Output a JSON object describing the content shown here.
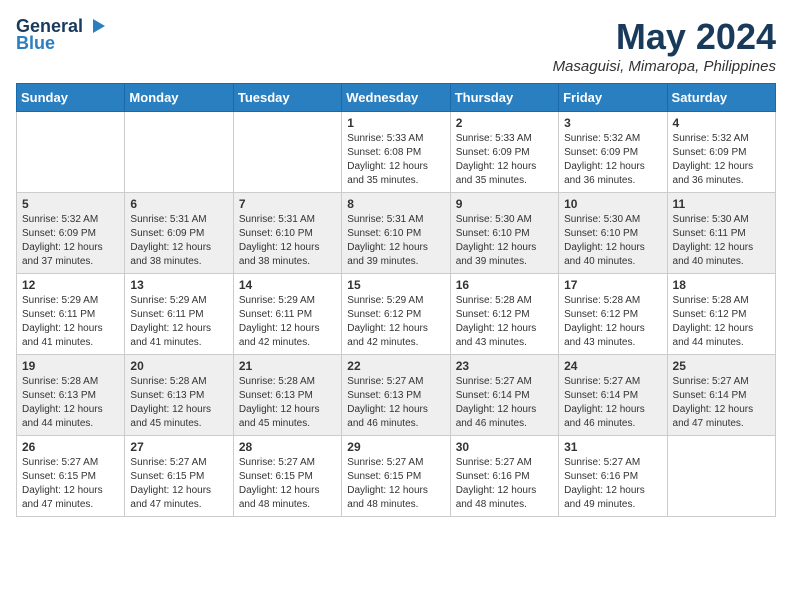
{
  "logo": {
    "general": "General",
    "blue": "Blue"
  },
  "title": {
    "month": "May 2024",
    "location": "Masaguisi, Mimaropa, Philippines"
  },
  "days_of_week": [
    "Sunday",
    "Monday",
    "Tuesday",
    "Wednesday",
    "Thursday",
    "Friday",
    "Saturday"
  ],
  "weeks": [
    [
      {
        "day": "",
        "info": ""
      },
      {
        "day": "",
        "info": ""
      },
      {
        "day": "",
        "info": ""
      },
      {
        "day": "1",
        "info": "Sunrise: 5:33 AM\nSunset: 6:08 PM\nDaylight: 12 hours\nand 35 minutes."
      },
      {
        "day": "2",
        "info": "Sunrise: 5:33 AM\nSunset: 6:09 PM\nDaylight: 12 hours\nand 35 minutes."
      },
      {
        "day": "3",
        "info": "Sunrise: 5:32 AM\nSunset: 6:09 PM\nDaylight: 12 hours\nand 36 minutes."
      },
      {
        "day": "4",
        "info": "Sunrise: 5:32 AM\nSunset: 6:09 PM\nDaylight: 12 hours\nand 36 minutes."
      }
    ],
    [
      {
        "day": "5",
        "info": "Sunrise: 5:32 AM\nSunset: 6:09 PM\nDaylight: 12 hours\nand 37 minutes."
      },
      {
        "day": "6",
        "info": "Sunrise: 5:31 AM\nSunset: 6:09 PM\nDaylight: 12 hours\nand 38 minutes."
      },
      {
        "day": "7",
        "info": "Sunrise: 5:31 AM\nSunset: 6:10 PM\nDaylight: 12 hours\nand 38 minutes."
      },
      {
        "day": "8",
        "info": "Sunrise: 5:31 AM\nSunset: 6:10 PM\nDaylight: 12 hours\nand 39 minutes."
      },
      {
        "day": "9",
        "info": "Sunrise: 5:30 AM\nSunset: 6:10 PM\nDaylight: 12 hours\nand 39 minutes."
      },
      {
        "day": "10",
        "info": "Sunrise: 5:30 AM\nSunset: 6:10 PM\nDaylight: 12 hours\nand 40 minutes."
      },
      {
        "day": "11",
        "info": "Sunrise: 5:30 AM\nSunset: 6:11 PM\nDaylight: 12 hours\nand 40 minutes."
      }
    ],
    [
      {
        "day": "12",
        "info": "Sunrise: 5:29 AM\nSunset: 6:11 PM\nDaylight: 12 hours\nand 41 minutes."
      },
      {
        "day": "13",
        "info": "Sunrise: 5:29 AM\nSunset: 6:11 PM\nDaylight: 12 hours\nand 41 minutes."
      },
      {
        "day": "14",
        "info": "Sunrise: 5:29 AM\nSunset: 6:11 PM\nDaylight: 12 hours\nand 42 minutes."
      },
      {
        "day": "15",
        "info": "Sunrise: 5:29 AM\nSunset: 6:12 PM\nDaylight: 12 hours\nand 42 minutes."
      },
      {
        "day": "16",
        "info": "Sunrise: 5:28 AM\nSunset: 6:12 PM\nDaylight: 12 hours\nand 43 minutes."
      },
      {
        "day": "17",
        "info": "Sunrise: 5:28 AM\nSunset: 6:12 PM\nDaylight: 12 hours\nand 43 minutes."
      },
      {
        "day": "18",
        "info": "Sunrise: 5:28 AM\nSunset: 6:12 PM\nDaylight: 12 hours\nand 44 minutes."
      }
    ],
    [
      {
        "day": "19",
        "info": "Sunrise: 5:28 AM\nSunset: 6:13 PM\nDaylight: 12 hours\nand 44 minutes."
      },
      {
        "day": "20",
        "info": "Sunrise: 5:28 AM\nSunset: 6:13 PM\nDaylight: 12 hours\nand 45 minutes."
      },
      {
        "day": "21",
        "info": "Sunrise: 5:28 AM\nSunset: 6:13 PM\nDaylight: 12 hours\nand 45 minutes."
      },
      {
        "day": "22",
        "info": "Sunrise: 5:27 AM\nSunset: 6:13 PM\nDaylight: 12 hours\nand 46 minutes."
      },
      {
        "day": "23",
        "info": "Sunrise: 5:27 AM\nSunset: 6:14 PM\nDaylight: 12 hours\nand 46 minutes."
      },
      {
        "day": "24",
        "info": "Sunrise: 5:27 AM\nSunset: 6:14 PM\nDaylight: 12 hours\nand 46 minutes."
      },
      {
        "day": "25",
        "info": "Sunrise: 5:27 AM\nSunset: 6:14 PM\nDaylight: 12 hours\nand 47 minutes."
      }
    ],
    [
      {
        "day": "26",
        "info": "Sunrise: 5:27 AM\nSunset: 6:15 PM\nDaylight: 12 hours\nand 47 minutes."
      },
      {
        "day": "27",
        "info": "Sunrise: 5:27 AM\nSunset: 6:15 PM\nDaylight: 12 hours\nand 47 minutes."
      },
      {
        "day": "28",
        "info": "Sunrise: 5:27 AM\nSunset: 6:15 PM\nDaylight: 12 hours\nand 48 minutes."
      },
      {
        "day": "29",
        "info": "Sunrise: 5:27 AM\nSunset: 6:15 PM\nDaylight: 12 hours\nand 48 minutes."
      },
      {
        "day": "30",
        "info": "Sunrise: 5:27 AM\nSunset: 6:16 PM\nDaylight: 12 hours\nand 48 minutes."
      },
      {
        "day": "31",
        "info": "Sunrise: 5:27 AM\nSunset: 6:16 PM\nDaylight: 12 hours\nand 49 minutes."
      },
      {
        "day": "",
        "info": ""
      }
    ]
  ]
}
